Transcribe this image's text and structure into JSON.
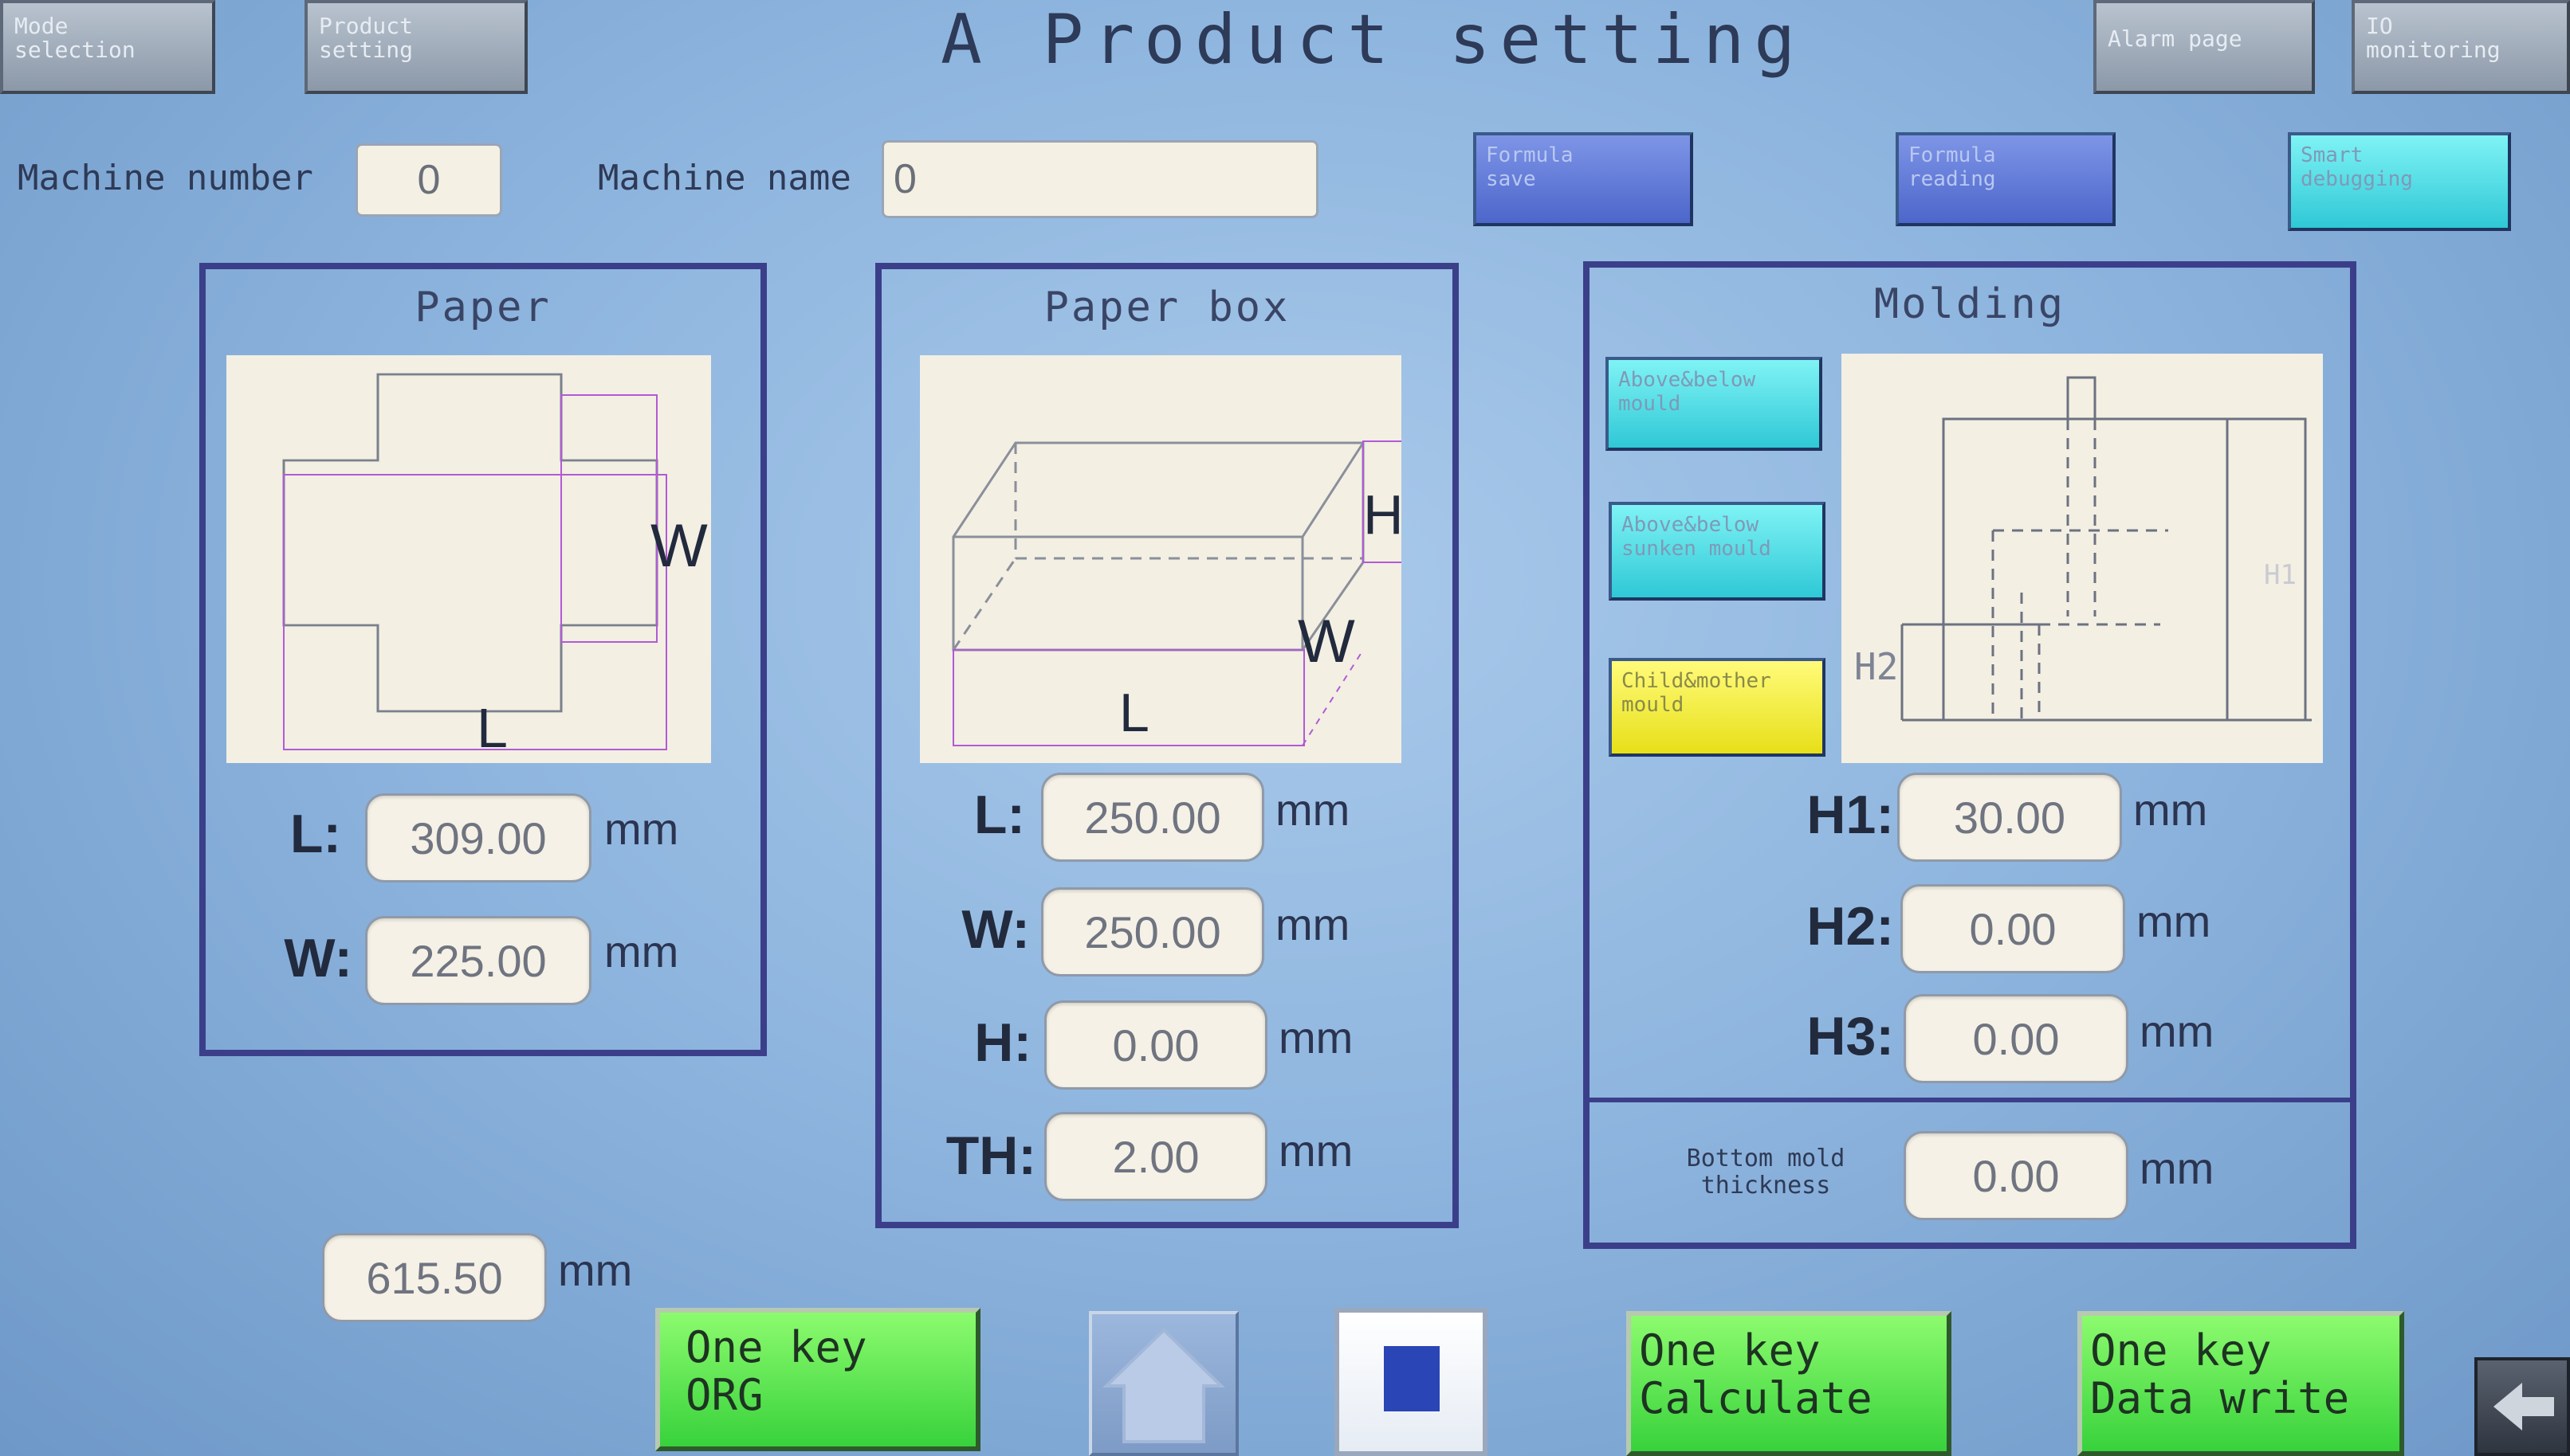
{
  "nav": {
    "mode_selection": "Mode\nselection",
    "product_setting": "Product\nsetting",
    "alarm_page": "Alarm page",
    "io_monitoring": "IO\nmonitoring"
  },
  "title": "A Product setting",
  "machine": {
    "number_label": "Machine number",
    "number_value": "0",
    "name_label": "Machine name",
    "name_value": "0"
  },
  "actions": {
    "formula_save": "Formula\nsave",
    "formula_reading": "Formula\nreading",
    "smart_debugging": "Smart\ndebugging"
  },
  "paper": {
    "title": "Paper",
    "diag_w": "W",
    "diag_l": "L",
    "l_label": "L:",
    "l_value": "309.00",
    "w_label": "W:",
    "w_value": "225.00",
    "unit": "mm"
  },
  "paper_box": {
    "title": "Paper  box",
    "diag_h": "H",
    "diag_w": "W",
    "diag_l": "L",
    "l_label": "L:",
    "l_value": "250.00",
    "w_label": "W:",
    "w_value": "250.00",
    "h_label": "H:",
    "h_value": "0.00",
    "th_label": "TH:",
    "th_value": "2.00",
    "unit": "mm"
  },
  "molding": {
    "title": "Molding",
    "mould_above_below": "Above&below\nmould",
    "mould_sunken": "Above&below\nsunken mould",
    "mould_child_mother": "Child&mother\nmould",
    "diag_h1": "H1",
    "diag_h2": "H2",
    "h1_label": "H1:",
    "h1_value": "30.00",
    "h2_label": "H2:",
    "h2_value": "0.00",
    "h3_label": "H3:",
    "h3_value": "0.00",
    "bottom_label": "Bottom mold\nthickness",
    "bottom_value": "0.00",
    "unit": "mm"
  },
  "total": {
    "value": "615.50",
    "unit": "mm"
  },
  "bottom": {
    "one_key_org": "One key\nORG",
    "one_key_calculate": "One key\nCalculate",
    "one_key_data_write": "One key\nData write"
  },
  "colors": {
    "panel_border": "#3b3f8a",
    "green_button": "#38d23c",
    "blue_button": "#4c66cb",
    "cyan_button": "#2fc8d6",
    "yellow_button": "#e7df18"
  }
}
